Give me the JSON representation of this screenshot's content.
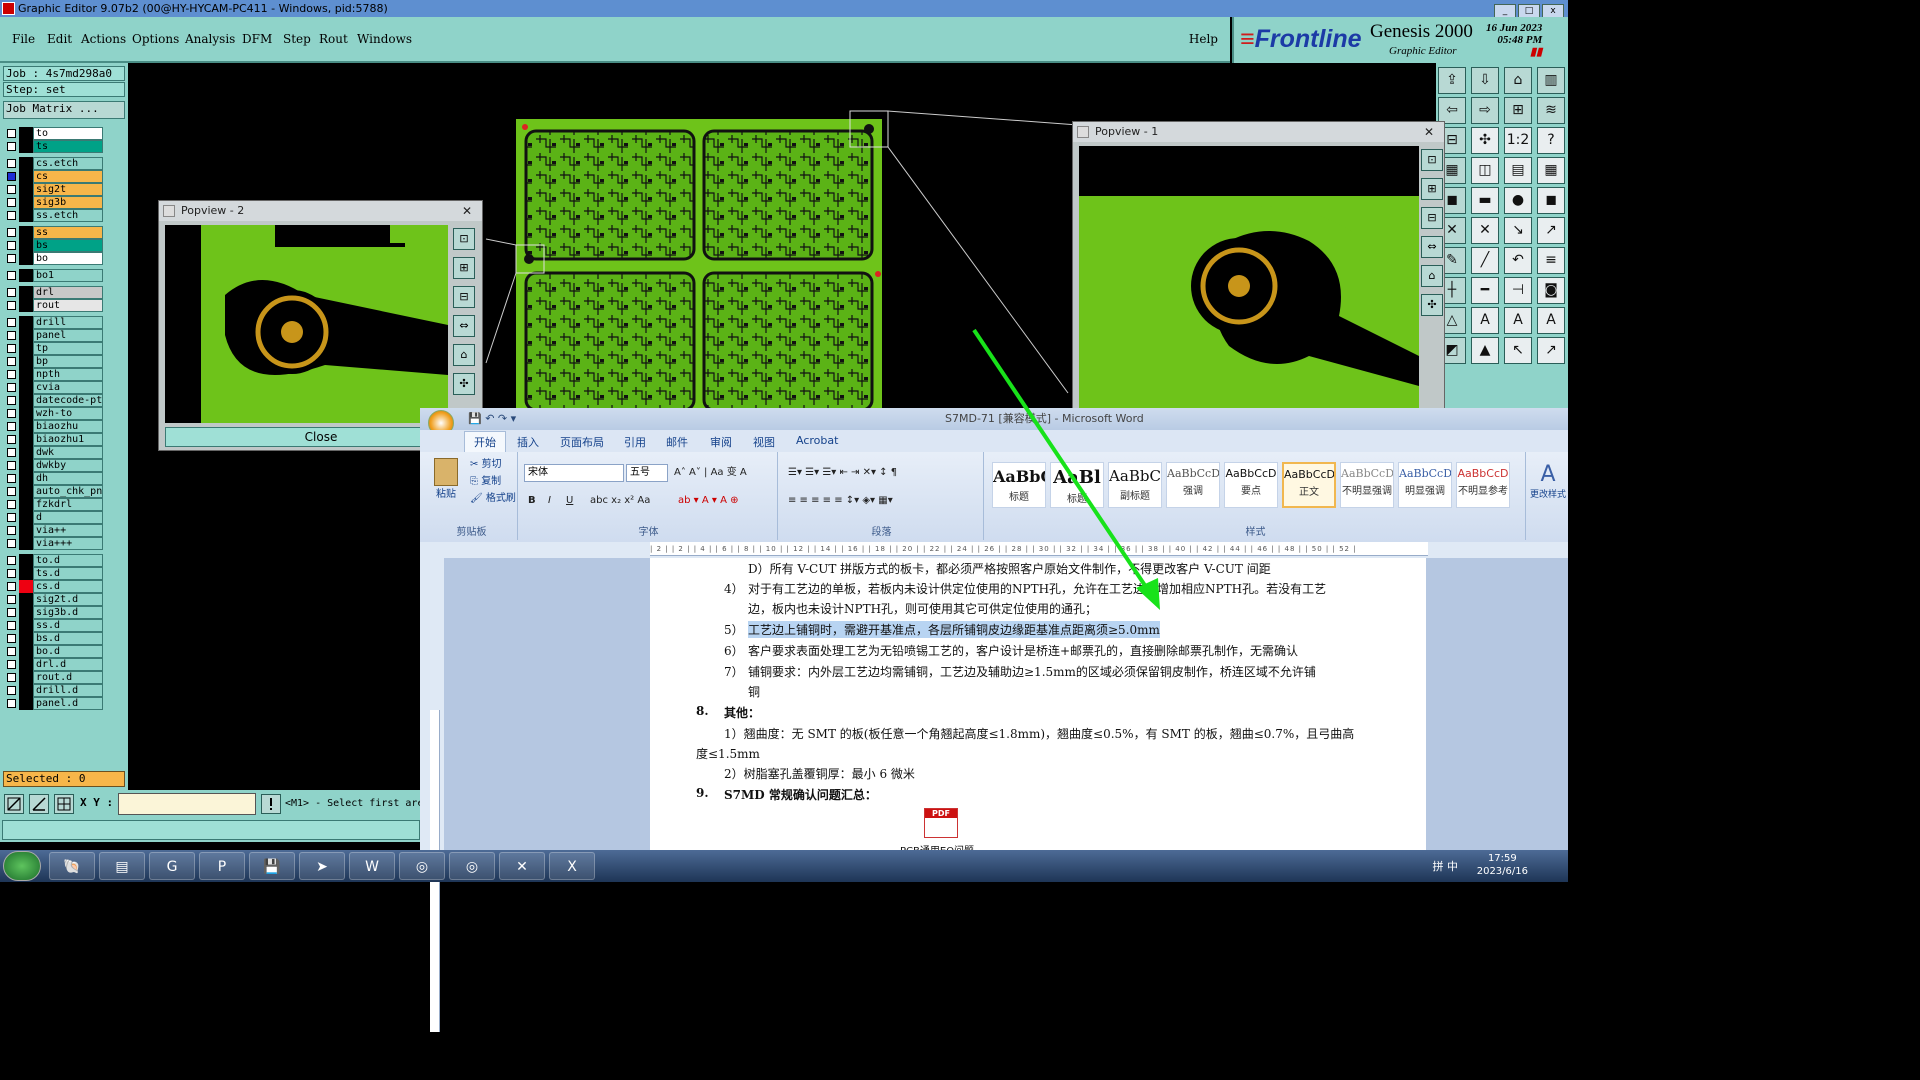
{
  "window": {
    "title": "Graphic Editor 9.07b2 (00@HY-HYCAM-PC411 - Windows, pid:5788)"
  },
  "menu": {
    "items": [
      "File",
      "Edit",
      "Actions",
      "Options",
      "Analysis",
      "DFM",
      "Step",
      "Rout",
      "Windows"
    ],
    "help": "Help"
  },
  "brand": {
    "logo": "Frontline",
    "product": "Genesis 2000",
    "subtitle": "Graphic Editor",
    "date": "16 Jun 2023",
    "time": "05:48 PM"
  },
  "job": {
    "job": "Job : 4s7md298a0",
    "step": "Step: set",
    "matrix": "Job Matrix ..."
  },
  "layers": [
    {
      "name": "to",
      "color": "#ffffff"
    },
    {
      "name": "ts",
      "color": "#00a287"
    },
    {
      "name": "cs.etch",
      "color": "#8fd3c9"
    },
    {
      "name": "cs",
      "color": "#f7b64a",
      "active": true
    },
    {
      "name": "sig2t",
      "color": "#f7b64a"
    },
    {
      "name": "sig3b",
      "color": "#f7b64a"
    },
    {
      "name": "ss.etch",
      "color": "#8fd3c9"
    },
    {
      "name": "ss",
      "color": "#f7b64a"
    },
    {
      "name": "bs",
      "color": "#00a287"
    },
    {
      "name": "bo",
      "color": "#ffffff"
    },
    {
      "name": "bo1",
      "color": "#8fd3c9"
    },
    {
      "name": "drl",
      "color": "#c8c8c8"
    },
    {
      "name": "rout",
      "color": "#e6e6e6"
    },
    {
      "name": "drill",
      "color": "#8fd3c9"
    },
    {
      "name": "panel",
      "color": "#8fd3c9"
    },
    {
      "name": "tp",
      "color": "#8fd3c9"
    },
    {
      "name": "bp",
      "color": "#8fd3c9"
    },
    {
      "name": "npth",
      "color": "#8fd3c9"
    },
    {
      "name": "cvia",
      "color": "#8fd3c9"
    },
    {
      "name": "datecode-pte",
      "color": "#8fd3c9"
    },
    {
      "name": "wzh-to",
      "color": "#8fd3c9"
    },
    {
      "name": "biaozhu",
      "color": "#8fd3c9"
    },
    {
      "name": "biaozhu1",
      "color": "#8fd3c9"
    },
    {
      "name": "dwk",
      "color": "#8fd3c9"
    },
    {
      "name": "dwkby",
      "color": "#8fd3c9"
    },
    {
      "name": "dh",
      "color": "#8fd3c9"
    },
    {
      "name": "auto_chk_pn",
      "color": "#8fd3c9"
    },
    {
      "name": "fzkdrl",
      "color": "#8fd3c9"
    },
    {
      "name": "d",
      "color": "#8fd3c9"
    },
    {
      "name": "via++",
      "color": "#8fd3c9"
    },
    {
      "name": "via+++",
      "color": "#8fd3c9"
    },
    {
      "name": "to.d",
      "color": "#8fd3c9"
    },
    {
      "name": "ts.d",
      "color": "#8fd3c9"
    },
    {
      "name": "cs.d",
      "color": "#8fd3c9",
      "red": true
    },
    {
      "name": "sig2t.d",
      "color": "#8fd3c9"
    },
    {
      "name": "sig3b.d",
      "color": "#8fd3c9"
    },
    {
      "name": "ss.d",
      "color": "#8fd3c9"
    },
    {
      "name": "bs.d",
      "color": "#8fd3c9"
    },
    {
      "name": "bo.d",
      "color": "#8fd3c9"
    },
    {
      "name": "drl.d",
      "color": "#8fd3c9"
    },
    {
      "name": "rout.d",
      "color": "#8fd3c9"
    },
    {
      "name": "drill.d",
      "color": "#8fd3c9"
    },
    {
      "name": "panel.d",
      "color": "#8fd3c9"
    }
  ],
  "selected": "Selected : 0",
  "status": {
    "xy_label": "X Y :",
    "hint": "<M1> - Select first are"
  },
  "popview2": {
    "title": "Popview - 2",
    "close": "Close"
  },
  "popview1": {
    "title": "Popview - 1"
  },
  "word": {
    "title": "S7MD-71 [兼容模式] - Microsoft Word",
    "tabs": [
      "开始",
      "插入",
      "页面布局",
      "引用",
      "邮件",
      "审阅",
      "视图",
      "Acrobat"
    ],
    "clipboard": {
      "paste": "粘贴",
      "cut": "剪切",
      "copy": "复制",
      "format": "格式刷",
      "group": "剪贴板"
    },
    "font": {
      "name": "宋体",
      "size": "五号",
      "group": "字体"
    },
    "paragraph_group": "段落",
    "styles": [
      {
        "preview": "AaBbC",
        "label": "标题"
      },
      {
        "preview": "AaBl",
        "label": "标题"
      },
      {
        "preview": "AaBbC",
        "label": "副标题"
      },
      {
        "preview": "AaBbCcD",
        "label": "强调"
      },
      {
        "preview": "AaBbCcD",
        "label": "要点"
      },
      {
        "preview": "AaBbCcD",
        "label": "正文",
        "selected": true
      },
      {
        "preview": "AaBbCcD",
        "label": "不明显强调"
      },
      {
        "preview": "AaBbCcD",
        "label": "明显强调"
      },
      {
        "preview": "AaBbCcD",
        "label": "不明显参考"
      }
    ],
    "styles_group": "样式",
    "change_styles": "更改样式",
    "ruler": "| 2 |   | 2 |   | 4 |   | 6 |   | 8 |   | 10 |   | 12 |   | 14 |   | 16 |   | 18 |   | 20 |   | 22 |   | 24 |   | 26 |   | 28 |   | 30 |   | 32 |   | 34 |   | 36 |   | 38 |   | 40 |   | 42 |   | 44 |   | 46 |   | 48 |   | 50 |   | 52 |",
    "doc": {
      "l1": "D）所有 V-CUT 拼版方式的板卡，都必须严格按照客户原始文件制作，不得更改客户 V-CUT 间距",
      "l2n": "4）",
      "l2": "对于有工艺边的单板，若板内未设计供定位使用的NPTH孔，允许在工艺边上增加相应NPTH孔。若没有工艺",
      "l3": "边，板内也未设计NPTH孔，则可使用其它可供定位使用的通孔；",
      "l4n": "5）",
      "l4": "工艺边上铺铜时，需避开基准点，各层所铺铜皮边缘距基准点距离须≥5.0mm",
      "l5n": "6）",
      "l5": "客户要求表面处理工艺为无铅喷锡工艺的，客户设计是桥连+邮票孔的，直接删除邮票孔制作，无需确认",
      "l6n": "7）",
      "l6": "铺铜要求：内外层工艺边均需铺铜，工艺边及辅助边≥1.5mm的区域必须保留铜皮制作，桥连区域不允许铺",
      "l7": "铜",
      "h8n": "8.",
      "h8": "其他：",
      "l8": "1）翘曲度：无 SMT 的板(板任意一个角翘起高度≤1.8mm)，翘曲度≤0.5%，有 SMT 的板，翘曲≤0.7%，且弓曲高",
      "l9": "度≤1.5mm",
      "l10": "2）树脂塞孔盖覆铜厚：最小 6 微米",
      "h9n": "9.",
      "h9": "S7MD 常规确认问题汇总：",
      "attach": "PCB通用EQ问题"
    }
  },
  "taskbar": {
    "tray": "拼 中",
    "time": "17:59",
    "date": "2023/6/16"
  },
  "colors": {
    "pcb_green": "#6ec31a",
    "pad_ring": "#c8951a",
    "teal": "#8fd3c9",
    "arrow": "#18e21a"
  }
}
